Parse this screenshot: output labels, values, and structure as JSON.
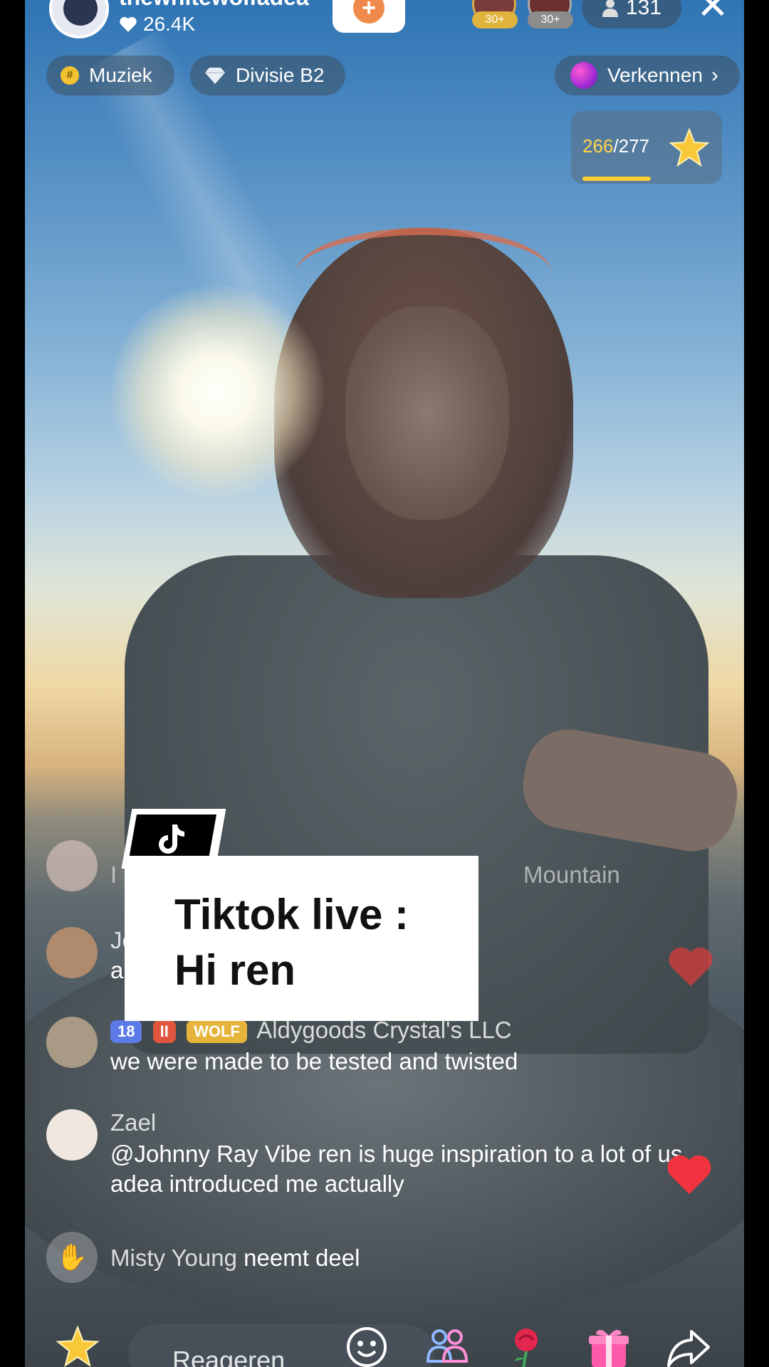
{
  "host": {
    "name": "thewhitewolfadea",
    "likes": "26.4K"
  },
  "gifters": [
    {
      "badge": "30+"
    },
    {
      "badge": "30+"
    }
  ],
  "viewer_count": "131",
  "tags": {
    "category": "Muziek",
    "division": "Divisie B2",
    "explore": "Verkennen"
  },
  "goal": {
    "current": "266",
    "total": "277",
    "progress": 0.96
  },
  "overlay": {
    "line1": "Tiktok live :",
    "line2": "Hi ren"
  },
  "chat": [
    {
      "name": "",
      "message_visible_left": "I be",
      "message_visible_right": "Mountain"
    },
    {
      "name_partial": "Joh",
      "message_partial": "am"
    },
    {
      "badges": [
        "18",
        "II",
        "WOLF"
      ],
      "name": "Aldygoods Crystal's LLC",
      "message": "we were made to be tested and twisted"
    },
    {
      "name": "Zael",
      "message": "@Johnny Ray Vibe ren is huge inspiration to a lot of us, adea introduced me actually"
    },
    {
      "name": "Misty Young",
      "action": "neemt deel"
    }
  ],
  "bottom_bar": {
    "comment_placeholder": "Reageren"
  },
  "icons": [
    "heart-icon",
    "close-icon",
    "person-icon",
    "star-icon",
    "smiley-icon",
    "multi-guest-icon",
    "rose-icon",
    "gift-icon",
    "share-icon",
    "wave-icon",
    "tiktok-logo-icon"
  ],
  "colors": {
    "goal_current": "#ffd54a",
    "follow_accent": "#f08a4c",
    "badge_blue": "#5d7be8",
    "badge_red": "#e0553e",
    "badge_gold": "#e6b43a"
  }
}
